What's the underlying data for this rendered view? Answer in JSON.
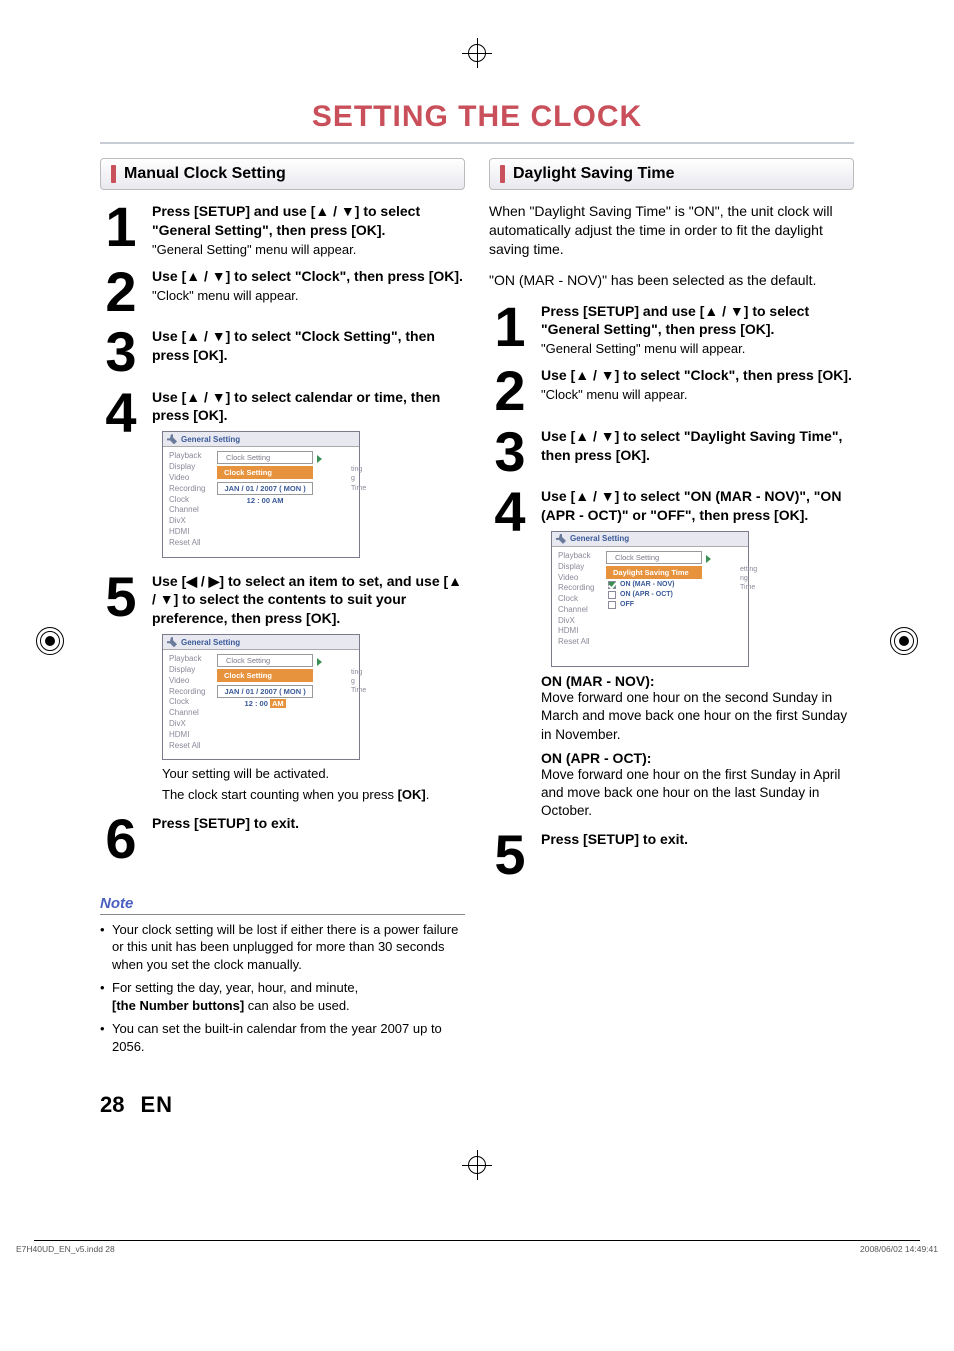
{
  "title": "SETTING THE CLOCK",
  "left": {
    "heading": "Manual Clock Setting",
    "steps": [
      {
        "num": "1",
        "lead": "Press [SETUP] and use [▲ / ▼] to select \"General Setting\", then press [OK].",
        "sub": "\"General Setting\" menu will appear."
      },
      {
        "num": "2",
        "lead": "Use [▲ / ▼] to select \"Clock\", then press [OK].",
        "sub": "\"Clock\" menu will appear."
      },
      {
        "num": "3",
        "lead": "Use [▲ / ▼] to select \"Clock Setting\", then press [OK].",
        "sub": ""
      },
      {
        "num": "4",
        "lead": "Use [▲ / ▼] to select calendar or time, then press [OK].",
        "sub": ""
      },
      {
        "num": "5",
        "lead": "Use [◀ / ▶] to select an item to set, and use [▲ / ▼] to select the contents to suit your preference, then press [OK].",
        "sub": ""
      },
      {
        "num": "6",
        "lead": "Press [SETUP] to exit.",
        "sub": ""
      }
    ],
    "menu": {
      "title": "General Setting",
      "items": [
        "Playback",
        "Display",
        "Video",
        "Recording",
        "Clock",
        "Channel",
        "DivX",
        "HDMI",
        "Reset All"
      ],
      "overlay_row1": "Clock Setting",
      "overlay_hl": "Clock Setting",
      "overlay_date": "JAN / 01 / 2007 ( MON )",
      "overlay_time": "12 : 00 AM",
      "side1": "ting",
      "side2": "g Time"
    },
    "menu2": {
      "overlay_time_parts": {
        "prefix": "12 : 00 ",
        "hl": "AM"
      }
    },
    "after1": "Your setting will be activated.",
    "after2_a": "The clock start counting when you press ",
    "after2_b": "[OK]",
    "after2_c": "."
  },
  "right": {
    "heading": "Daylight Saving Time",
    "intro1": "When \"Daylight Saving Time\" is \"ON\", the unit clock will automatically adjust the time in order to fit the daylight saving time.",
    "intro2": "\"ON (MAR - NOV)\" has been selected as the default.",
    "steps": [
      {
        "num": "1",
        "lead": "Press [SETUP] and use [▲ / ▼] to select \"General Setting\", then press [OK].",
        "sub": "\"General Setting\" menu will appear."
      },
      {
        "num": "2",
        "lead": "Use [▲ / ▼] to select \"Clock\", then press [OK].",
        "sub": "\"Clock\" menu will appear."
      },
      {
        "num": "3",
        "lead": "Use [▲ / ▼] to select \"Daylight Saving Time\", then press [OK].",
        "sub": ""
      },
      {
        "num": "4",
        "lead": "Use [▲ / ▼] to select \"ON (MAR - NOV)\", \"ON (APR - OCT)\" or \"OFF\", then press [OK].",
        "sub": ""
      },
      {
        "num": "5",
        "lead": "Press [SETUP] to exit.",
        "sub": ""
      }
    ],
    "menu": {
      "title": "General Setting",
      "items": [
        "Playback",
        "Display",
        "Video",
        "Recording",
        "Clock",
        "Channel",
        "DivX",
        "HDMI",
        "Reset All"
      ],
      "overlay_row1": "Clock Setting",
      "overlay_hl": "Daylight Saving Time",
      "opt1": "ON (MAR - NOV)",
      "opt2": "ON (APR - OCT)",
      "opt3": "OFF",
      "side1": "etting",
      "side2": "ng Time"
    },
    "on_mar_head": "ON (MAR - NOV):",
    "on_mar_body": "Move forward one hour on the second Sunday in March and move back one hour on the first Sunday in November.",
    "on_apr_head": "ON (APR - OCT):",
    "on_apr_body": "Move forward one hour on the first Sunday in April and move back one hour on the last Sunday in October."
  },
  "note": {
    "title": "Note",
    "items": [
      "Your clock setting will be lost if either there is a power failure or this unit has been unplugged for more than 30 seconds when you set the clock manually.",
      "For setting the day, year, hour, and minute, [the Number buttons] can also be used.",
      "You can set the built-in calendar from the year 2007 up to 2056."
    ],
    "bold_segment": "[the Number buttons]"
  },
  "page_num": "28",
  "page_lang": "EN",
  "footer_left": "E7H40UD_EN_v5.indd   28",
  "footer_right": "2008/06/02   14:49:41"
}
